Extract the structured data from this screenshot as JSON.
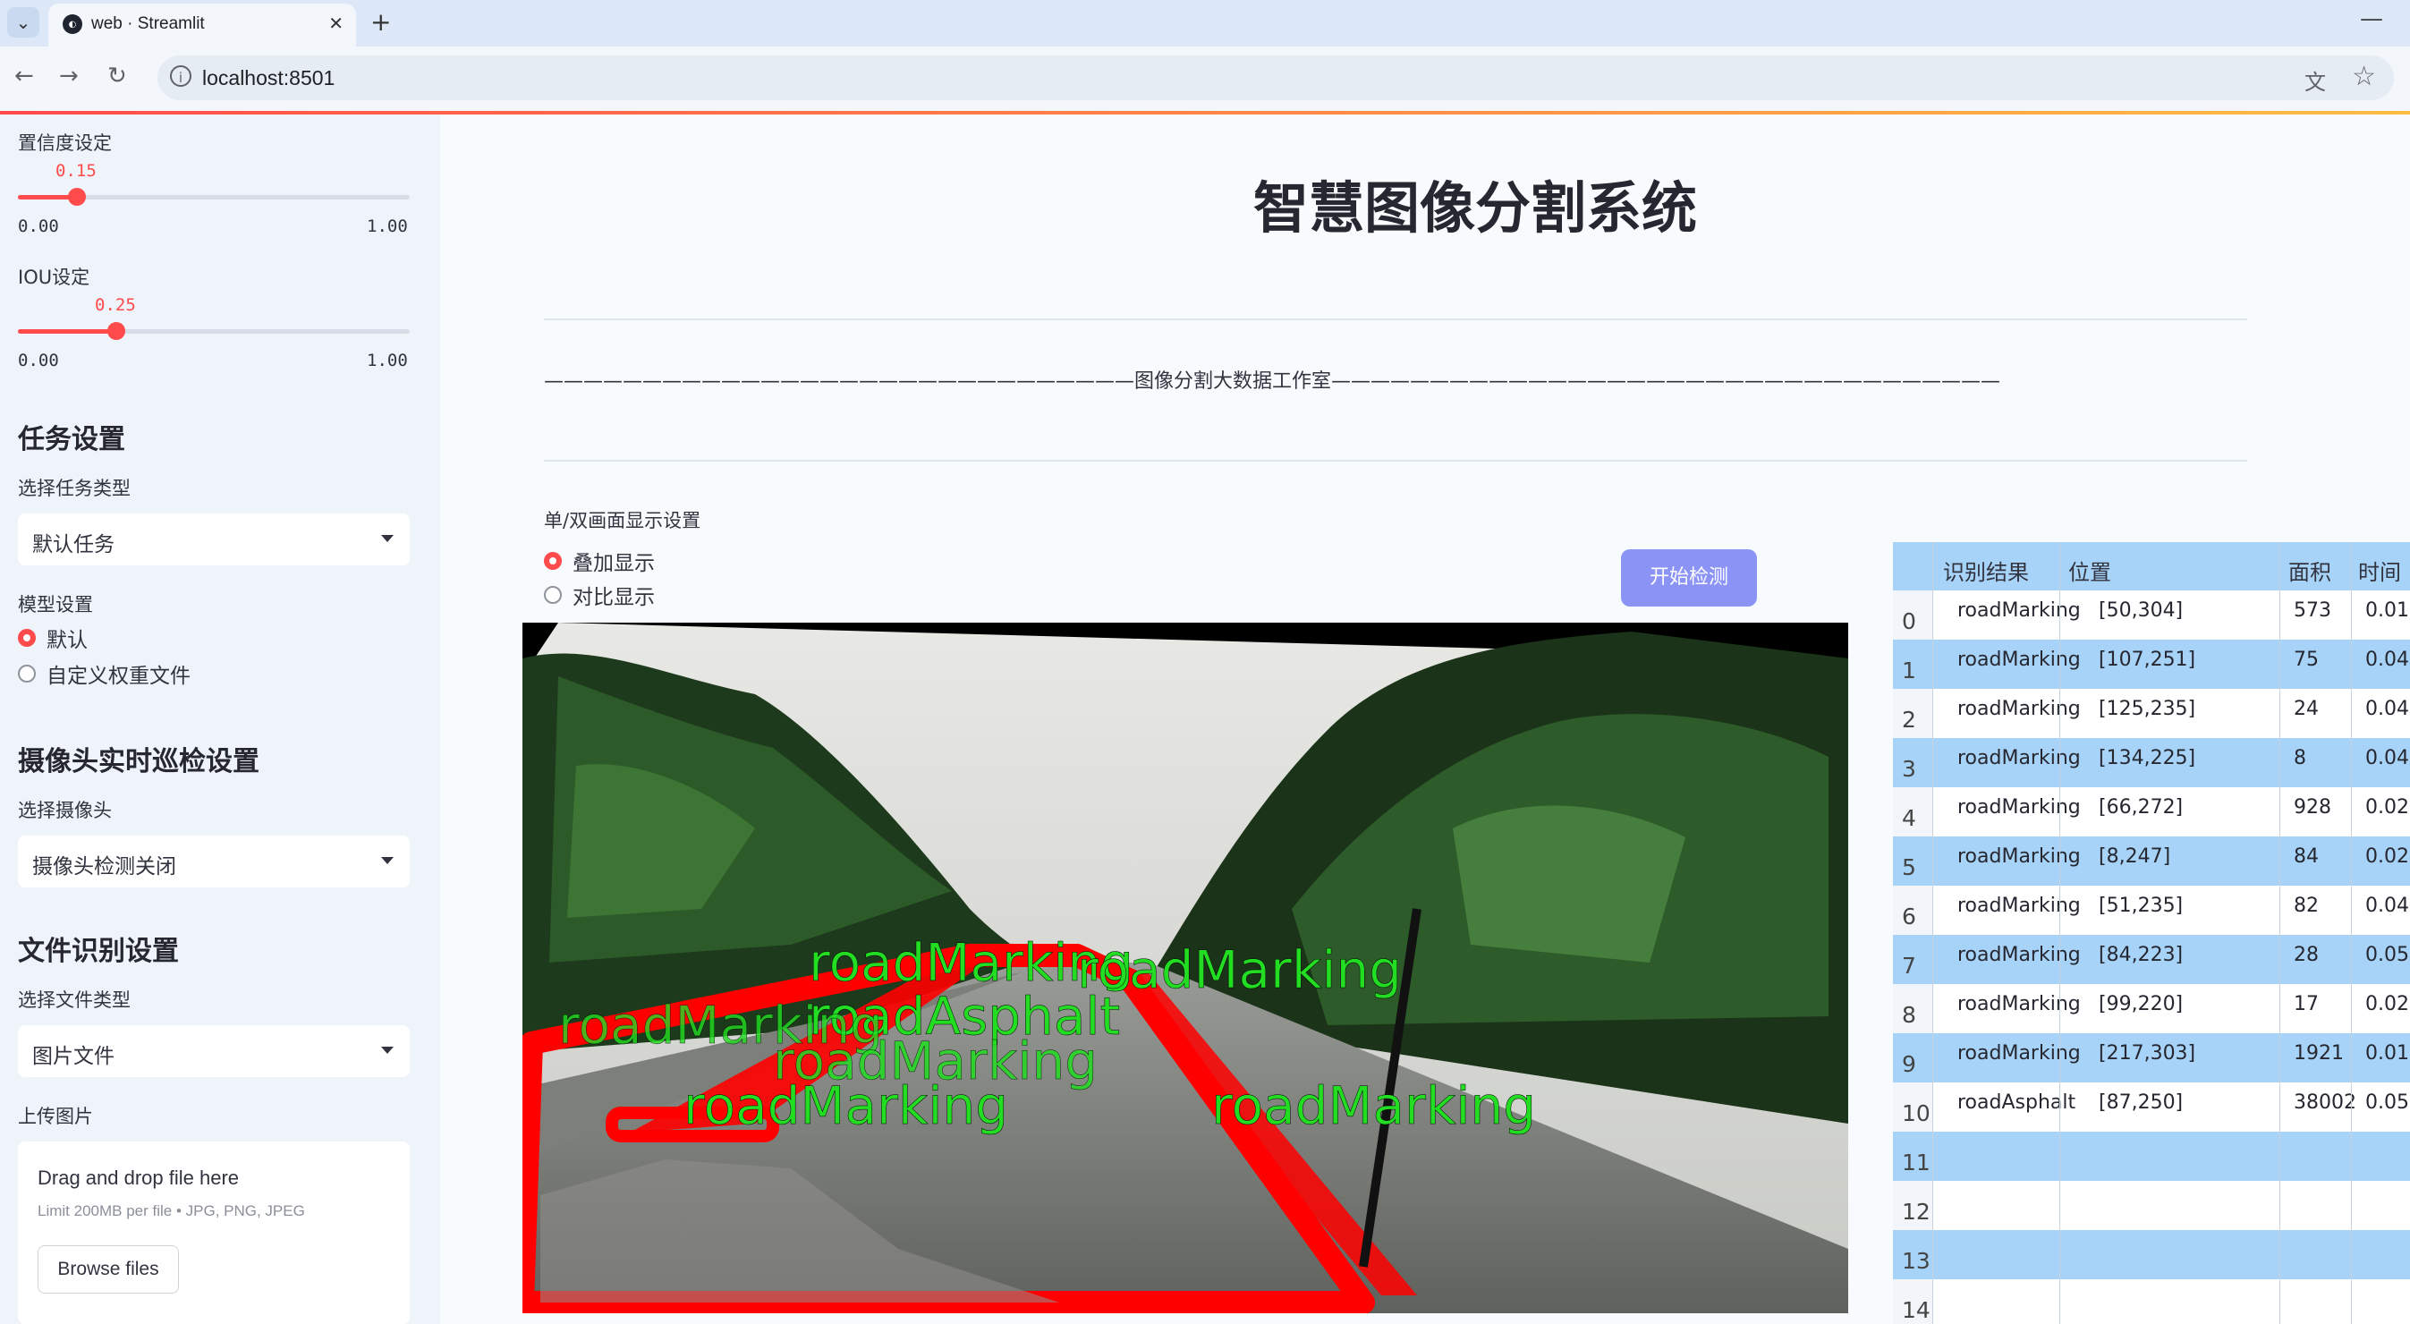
{
  "browser": {
    "tab_title": "web · Streamlit",
    "url": "localhost:8501"
  },
  "sidebar": {
    "confidence": {
      "label": "置信度设定",
      "value": "0.15",
      "min": "0.00",
      "max": "1.00",
      "fraction": 0.15
    },
    "iou": {
      "label": "IOU设定",
      "value": "0.25",
      "min": "0.00",
      "max": "1.00",
      "fraction": 0.25
    },
    "task_section": "任务设置",
    "task_type_label": "选择任务类型",
    "task_type_value": "默认任务",
    "model_label": "模型设置",
    "model_options": [
      "默认",
      "自定义权重文件"
    ],
    "camera_section": "摄像头实时巡检设置",
    "camera_label": "选择摄像头",
    "camera_value": "摄像头检测关闭",
    "file_section": "文件识别设置",
    "file_type_label": "选择文件类型",
    "file_type_value": "图片文件",
    "upload_label": "上传图片",
    "upload_title": "Drag and drop file here",
    "upload_sub": "Limit 200MB per file • JPG, PNG, JPEG",
    "browse_label": "Browse files"
  },
  "main": {
    "title": "智慧图像分割系统",
    "subtitle": "——————————————————————————————图像分割大数据工作室——————————————————————————————————",
    "display_label": "单/双画面显示设置",
    "display_options": [
      "叠加显示",
      "对比显示"
    ],
    "start_button": "开始检测"
  },
  "overlay_labels": [
    "roadMarking",
    "roadMarking",
    "roadAsphalt",
    "roadMarking",
    "roadMarking",
    "roadMarking",
    "roadMarking"
  ],
  "colors": {
    "accent": "#ff4b4b",
    "button": "#8b93f5",
    "grid_band": "#a6d3f7",
    "mask": "#ff0000",
    "label": "#22dd22"
  },
  "results": {
    "columns": [
      "识别结果",
      "位置",
      "面积",
      "时间"
    ],
    "rows": [
      {
        "index": "0",
        "label": "roadMarking",
        "pos": "[50,304]",
        "area": "573",
        "time": "0.01"
      },
      {
        "index": "1",
        "label": "roadMarking",
        "pos": "[107,251]",
        "area": "75",
        "time": "0.04"
      },
      {
        "index": "2",
        "label": "roadMarking",
        "pos": "[125,235]",
        "area": "24",
        "time": "0.04"
      },
      {
        "index": "3",
        "label": "roadMarking",
        "pos": "[134,225]",
        "area": "8",
        "time": "0.04"
      },
      {
        "index": "4",
        "label": "roadMarking",
        "pos": "[66,272]",
        "area": "928",
        "time": "0.02"
      },
      {
        "index": "5",
        "label": "roadMarking",
        "pos": "[8,247]",
        "area": "84",
        "time": "0.02"
      },
      {
        "index": "6",
        "label": "roadMarking",
        "pos": "[51,235]",
        "area": "82",
        "time": "0.04"
      },
      {
        "index": "7",
        "label": "roadMarking",
        "pos": "[84,223]",
        "area": "28",
        "time": "0.05"
      },
      {
        "index": "8",
        "label": "roadMarking",
        "pos": "[99,220]",
        "area": "17",
        "time": "0.02"
      },
      {
        "index": "9",
        "label": "roadMarking",
        "pos": "[217,303]",
        "area": "1921",
        "time": "0.01"
      },
      {
        "index": "10",
        "label": "roadAsphalt",
        "pos": "[87,250]",
        "area": "38002",
        "time": "0.05"
      },
      {
        "index": "11",
        "label": "",
        "pos": "",
        "area": "",
        "time": ""
      },
      {
        "index": "12",
        "label": "",
        "pos": "",
        "area": "",
        "time": ""
      },
      {
        "index": "13",
        "label": "",
        "pos": "",
        "area": "",
        "time": ""
      },
      {
        "index": "14",
        "label": "",
        "pos": "",
        "area": "",
        "time": ""
      }
    ]
  }
}
